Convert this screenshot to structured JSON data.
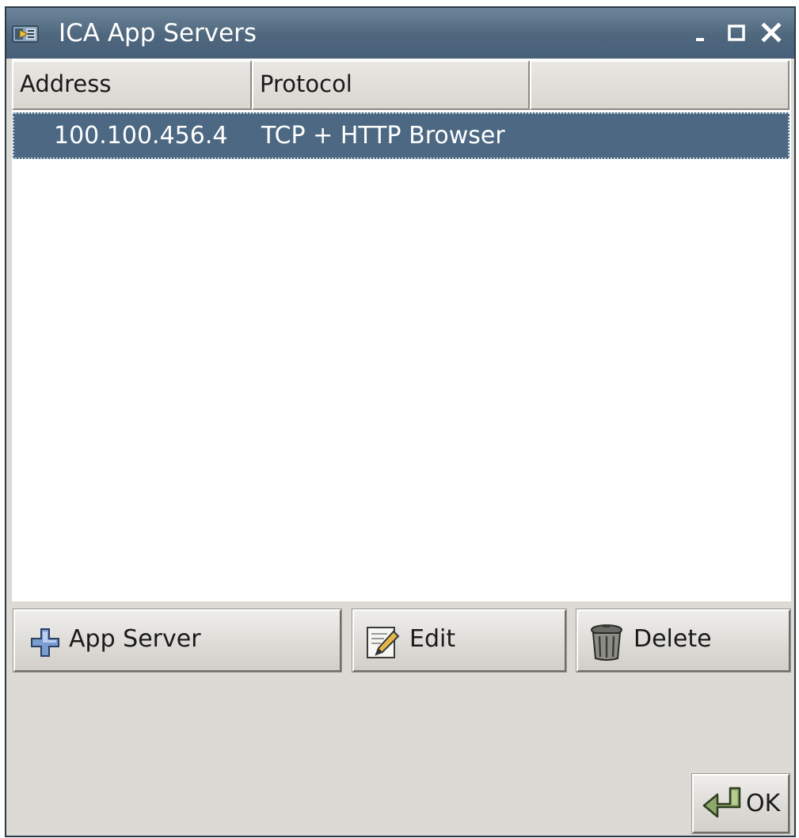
{
  "window": {
    "title": "ICA App Servers",
    "icon": "ica-app-icon",
    "controls": [
      "minimize-icon",
      "maximize-icon",
      "close-icon"
    ]
  },
  "table": {
    "columns": [
      "Address",
      "Protocol",
      ""
    ],
    "rows": [
      {
        "address": "100.100.456.4",
        "protocol": "TCP + HTTP Browser",
        "selected": true
      }
    ]
  },
  "actions": {
    "add_label": "App Server",
    "add_icon": "plus-icon",
    "edit_label": "Edit",
    "edit_icon": "edit-pencil-icon",
    "delete_label": "Delete",
    "delete_icon": "trash-can-icon"
  },
  "footer": {
    "ok_label": "OK",
    "ok_icon": "enter-arrow-icon"
  },
  "colors": {
    "titlebar": "#4f677d",
    "selection": "#4c6883",
    "window_bg": "#dcdad5"
  }
}
